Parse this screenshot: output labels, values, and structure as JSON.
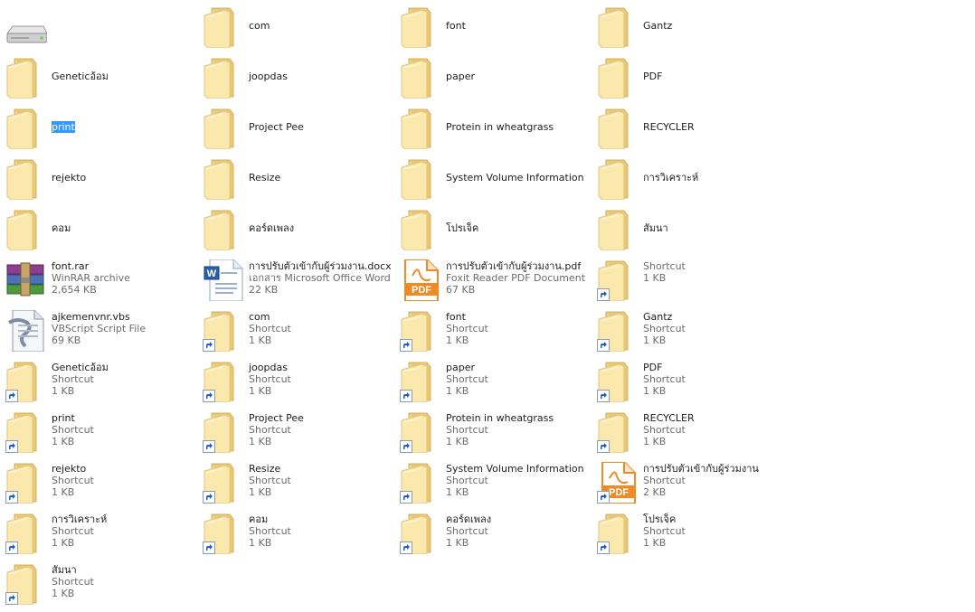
{
  "items": [
    {
      "name": "",
      "icon": "drive-icon"
    },
    {
      "name": "com",
      "icon": "folder-icon"
    },
    {
      "name": "font",
      "icon": "folder-icon"
    },
    {
      "name": "Gantz",
      "icon": "folder-icon"
    },
    {
      "name": "Geneticอ้อม",
      "icon": "folder-icon"
    },
    {
      "name": "joopdas",
      "icon": "folder-icon"
    },
    {
      "name": "paper",
      "icon": "folder-icon"
    },
    {
      "name": "PDF",
      "icon": "folder-icon"
    },
    {
      "name": "print",
      "icon": "folder-icon",
      "selected": true
    },
    {
      "name": "Project Pee",
      "icon": "folder-icon"
    },
    {
      "name": "Protein in wheatgrass",
      "icon": "folder-icon"
    },
    {
      "name": "RECYCLER",
      "icon": "folder-icon"
    },
    {
      "name": "rejekto",
      "icon": "folder-icon"
    },
    {
      "name": "Resize",
      "icon": "folder-icon"
    },
    {
      "name": "System Volume Information",
      "icon": "folder-icon"
    },
    {
      "name": "การวิเคราะห์",
      "icon": "folder-icon"
    },
    {
      "name": "คอม",
      "icon": "folder-icon"
    },
    {
      "name": "คอร์ดเพลง",
      "icon": "folder-icon"
    },
    {
      "name": "โปรเจ็ค",
      "icon": "folder-icon"
    },
    {
      "name": "สัมนา",
      "icon": "folder-icon"
    },
    {
      "name": "font.rar",
      "type": "WinRAR archive",
      "size": "2,654 KB",
      "icon": "winrar-icon"
    },
    {
      "name": "การปรับตัวเข้ากับผู้ร่วมงาน.docx",
      "type": "เอกสาร Microsoft Office Word",
      "size": "22 KB",
      "icon": "word-doc-icon"
    },
    {
      "name": "การปรับตัวเข้ากับผู้ร่วมงาน.pdf",
      "type": "Foxit Reader PDF Document",
      "size": "67 KB",
      "icon": "pdf-icon"
    },
    {
      "name": "",
      "type": "Shortcut",
      "size": "1 KB",
      "icon": "folder-shortcut-icon"
    },
    {
      "name": "ajkemenvnr.vbs",
      "type": "VBScript Script File",
      "size": "69 KB",
      "icon": "vbs-script-icon"
    },
    {
      "name": "com",
      "type": "Shortcut",
      "size": "1 KB",
      "icon": "folder-shortcut-icon"
    },
    {
      "name": "font",
      "type": "Shortcut",
      "size": "1 KB",
      "icon": "folder-shortcut-icon"
    },
    {
      "name": "Gantz",
      "type": "Shortcut",
      "size": "1 KB",
      "icon": "folder-shortcut-icon"
    },
    {
      "name": "Geneticอ้อม",
      "type": "Shortcut",
      "size": "1 KB",
      "icon": "folder-shortcut-icon"
    },
    {
      "name": "joopdas",
      "type": "Shortcut",
      "size": "1 KB",
      "icon": "folder-shortcut-icon"
    },
    {
      "name": "paper",
      "type": "Shortcut",
      "size": "1 KB",
      "icon": "folder-shortcut-icon"
    },
    {
      "name": "PDF",
      "type": "Shortcut",
      "size": "1 KB",
      "icon": "folder-shortcut-icon"
    },
    {
      "name": "print",
      "type": "Shortcut",
      "size": "1 KB",
      "icon": "folder-shortcut-icon"
    },
    {
      "name": "Project Pee",
      "type": "Shortcut",
      "size": "1 KB",
      "icon": "folder-shortcut-icon"
    },
    {
      "name": "Protein in wheatgrass",
      "type": "Shortcut",
      "size": "1 KB",
      "icon": "folder-shortcut-icon"
    },
    {
      "name": "RECYCLER",
      "type": "Shortcut",
      "size": "1 KB",
      "icon": "folder-shortcut-icon"
    },
    {
      "name": "rejekto",
      "type": "Shortcut",
      "size": "1 KB",
      "icon": "folder-shortcut-icon"
    },
    {
      "name": "Resize",
      "type": "Shortcut",
      "size": "1 KB",
      "icon": "folder-shortcut-icon"
    },
    {
      "name": "System Volume Information",
      "type": "Shortcut",
      "size": "1 KB",
      "icon": "folder-shortcut-icon"
    },
    {
      "name": "การปรับตัวเข้ากับผู้ร่วมงาน",
      "type": "Shortcut",
      "size": "2 KB",
      "icon": "pdf-shortcut-icon"
    },
    {
      "name": "การวิเคราะห์",
      "type": "Shortcut",
      "size": "1 KB",
      "icon": "folder-shortcut-icon"
    },
    {
      "name": "คอม",
      "type": "Shortcut",
      "size": "1 KB",
      "icon": "folder-shortcut-icon"
    },
    {
      "name": "คอร์ดเพลง",
      "type": "Shortcut",
      "size": "1 KB",
      "icon": "folder-shortcut-icon"
    },
    {
      "name": "โปรเจ็ค",
      "type": "Shortcut",
      "size": "1 KB",
      "icon": "folder-shortcut-icon"
    },
    {
      "name": "สัมนา",
      "type": "Shortcut",
      "size": "1 KB",
      "icon": "folder-shortcut-icon"
    }
  ],
  "colors": {
    "folder_back": "#f2d58b",
    "folder_front": "#fbe9b0",
    "selection": "#3399ff",
    "meta_text": "#6d6d6d",
    "pdf_orange": "#f08a24"
  }
}
